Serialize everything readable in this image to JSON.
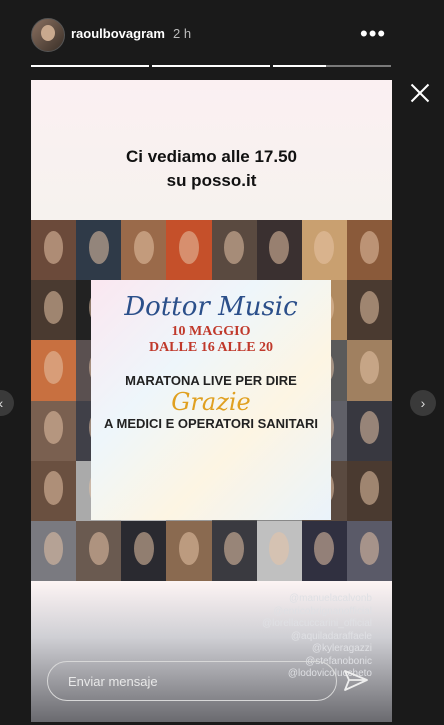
{
  "header": {
    "username": "raoulbovagram",
    "time": "2 h",
    "more_icon": "more-horizontal-icon"
  },
  "progress": [
    1,
    1,
    0.45
  ],
  "story": {
    "headline_line1": "Ci vediamo alle 17.50",
    "headline_line2": "su posso.it",
    "brand": "Dottor Music",
    "date_line1": "10 MAGGIO",
    "date_line2": "DALLE 16 ALLE 20",
    "tagline1": "MARATONA LIVE PER DIRE",
    "grazie": "Grazie",
    "tagline2": "A MEDICI E OPERATORI SANITARI",
    "mentions": [
      "@manuelacalvonb",
      "@enricobrignanofficial",
      "@lorellacuccarini_official",
      "@aquiladaraffaele",
      "@kyleragazzi",
      "@stefanobonic",
      "@lodovicoluccheto"
    ]
  },
  "reply": {
    "placeholder": "Enviar mensaje"
  },
  "colors": {
    "background": "#1a1a1a",
    "brand_blue": "#2b4f8a",
    "date_red": "#c0392b",
    "grazie_gold": "#e0a020"
  }
}
